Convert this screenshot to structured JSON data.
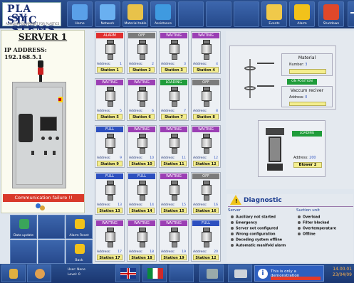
{
  "logo": {
    "line1": "PLA STIC",
    "line2": "SY STEMS",
    "tagline": "AUXILIARY EQUIPMENT FOR PLASTICS"
  },
  "toolbar": [
    {
      "label": "Home",
      "icon": "home-icon"
    },
    {
      "label": "Network",
      "icon": "network-icon"
    },
    {
      "label": "Material table",
      "icon": "folder-icon"
    },
    {
      "label": "Assistance",
      "icon": "globe-icon"
    },
    {
      "label": "",
      "icon": ""
    },
    {
      "label": "",
      "icon": ""
    },
    {
      "label": "",
      "icon": ""
    },
    {
      "label": "Events",
      "icon": "events-icon"
    },
    {
      "label": "Alarm",
      "icon": "alarm-icon"
    },
    {
      "label": "Shutdown",
      "icon": "power-icon"
    }
  ],
  "server": {
    "title": "SERVER 1",
    "ip_label": "IP ADDRESS:",
    "ip": "192.168.5.1",
    "status": "Communication failure !!"
  },
  "left_buttons": [
    {
      "label": "Data update",
      "icon": "refresh-icon"
    },
    {
      "label": "",
      "icon": ""
    },
    {
      "label": "Alarm Reset",
      "icon": "alarm-reset-icon"
    },
    {
      "label": "",
      "icon": ""
    },
    {
      "label": "",
      "icon": ""
    },
    {
      "label": "Back",
      "icon": "back-icon"
    }
  ],
  "stations": [
    {
      "status": "ALARM",
      "color": "#e02d2d",
      "address": "1",
      "name": "Station 1"
    },
    {
      "status": "OFF",
      "color": "#7b7b7b",
      "address": "2",
      "name": "Station 2"
    },
    {
      "status": "WAITING",
      "color": "#9b3fb4",
      "address": "3",
      "name": "Station 3"
    },
    {
      "status": "WAITING",
      "color": "#9b3fb4",
      "address": "4",
      "name": "Station 4"
    },
    {
      "status": "WAITING",
      "color": "#9b3fb4",
      "address": "5",
      "name": "Station 5"
    },
    {
      "status": "WAITING",
      "color": "#9b3fb4",
      "address": "6",
      "name": "Station 6"
    },
    {
      "status": "LOADING",
      "color": "#1f9c3a",
      "address": "7",
      "name": "Station 7"
    },
    {
      "status": "OFF",
      "color": "#7b7b7b",
      "address": "8",
      "name": "Station 8"
    },
    {
      "status": "FULL",
      "color": "#2c4fbf",
      "address": "9",
      "name": "Station 9"
    },
    {
      "status": "WAITING",
      "color": "#9b3fb4",
      "address": "10",
      "name": "Station 10"
    },
    {
      "status": "WAITING",
      "color": "#9b3fb4",
      "address": "11",
      "name": "Station 11"
    },
    {
      "status": "WAITING",
      "color": "#9b3fb4",
      "address": "12",
      "name": "Station 12"
    },
    {
      "status": "FULL",
      "color": "#2c4fbf",
      "address": "13",
      "name": "Station 13"
    },
    {
      "status": "FULL",
      "color": "#2c4fbf",
      "address": "14",
      "name": "Station 14"
    },
    {
      "status": "WAITING",
      "color": "#9b3fb4",
      "address": "15",
      "name": "Station 15"
    },
    {
      "status": "OFF",
      "color": "#7b7b7b",
      "address": "16",
      "name": "Station 16"
    },
    {
      "status": "WAITING",
      "color": "#9b3fb4",
      "address": "17",
      "name": "Station 17"
    },
    {
      "status": "WAITING",
      "color": "#9b3fb4",
      "address": "18",
      "name": "Station 18"
    },
    {
      "status": "WAITING",
      "color": "#9b3fb4",
      "address": "19",
      "name": "Station 19"
    },
    {
      "status": "FULL",
      "color": "#2c4fbf",
      "address": "20",
      "name": "Station 12"
    }
  ],
  "address_label": "Address:",
  "material": {
    "title": "Material",
    "number_label": "Number:",
    "number": "3",
    "position": "ON POSITION",
    "receiver_title": "Vaccum reciver",
    "receiver_address_label": "Address:",
    "receiver_address": "0"
  },
  "blower": {
    "status": "LOADING",
    "address_label": "Address:",
    "address": "200",
    "name": "Blower 2"
  },
  "diagnostic": {
    "title": "Diagnostic",
    "server_title": "Server",
    "suction_title": "Suction unit",
    "server_items": [
      "Auxiliary not started",
      "Emergency",
      "Server not configured",
      "Wrong configuration",
      "Decoding system offline",
      "Automatic manifold alarm"
    ],
    "suction_items": [
      "Overload",
      "Filter blocked",
      "Overtemperature",
      "Offline"
    ]
  },
  "bottom": {
    "user_label": "User:",
    "user": "None",
    "level_label": "Level:",
    "level": "0",
    "demo_text": "This is only a demonstration",
    "time": "14.00.01",
    "date": "23/04/09"
  }
}
